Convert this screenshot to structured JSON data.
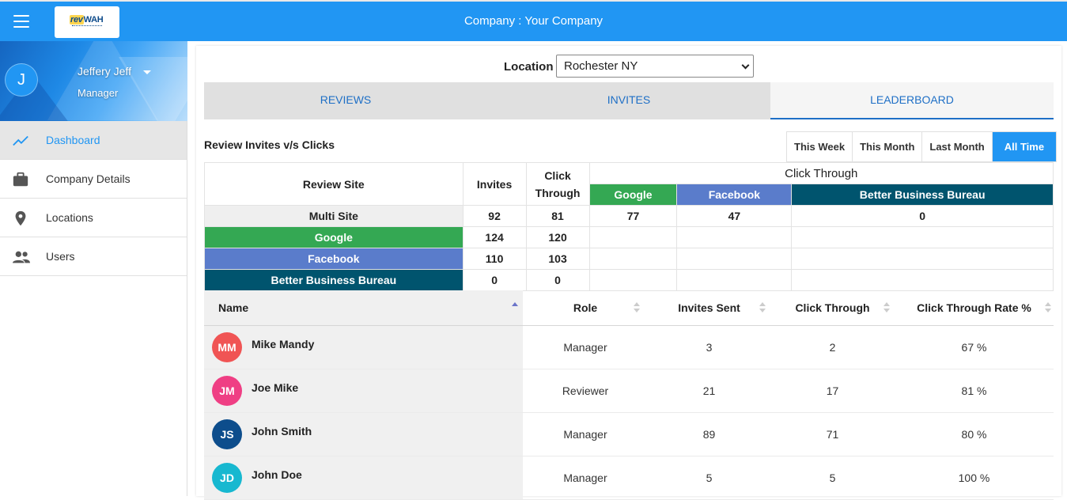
{
  "topbar": {
    "title": "Company : Your Company",
    "logo": {
      "rev": "rev",
      "wah": "WAH"
    }
  },
  "profile": {
    "initial": "J",
    "name": "Jeffery Jeff",
    "role": "Manager"
  },
  "nav": [
    {
      "label": "Dashboard",
      "icon": "trending-line-icon",
      "active": true
    },
    {
      "label": "Company Details",
      "icon": "briefcase-icon"
    },
    {
      "label": "Locations",
      "icon": "location-pin-icon"
    },
    {
      "label": "Users",
      "icon": "users-icon"
    }
  ],
  "location": {
    "label": "Location",
    "value": "Rochester NY"
  },
  "tabs": [
    {
      "label": "REVIEWS"
    },
    {
      "label": "INVITES"
    },
    {
      "label": "LEADERBOARD",
      "active": true
    }
  ],
  "section": {
    "title": "Review Invites v/s Clicks"
  },
  "ranges": [
    {
      "label": "This Week"
    },
    {
      "label": "This Month"
    },
    {
      "label": "Last Month"
    },
    {
      "label": "All Time",
      "active": true
    }
  ],
  "summary": {
    "head_site": "Review Site",
    "head_invites": "Invites",
    "head_click": "Click Through",
    "head_click_group": "Click Through",
    "sub_google": "Google",
    "sub_facebook": "Facebook",
    "sub_bbb": "Better Business Bureau",
    "rows": [
      {
        "site": "Multi Site",
        "invites": "92",
        "clicks": "81",
        "google": "77",
        "facebook": "47",
        "bbb": "0"
      },
      {
        "site": "Google",
        "invites": "124",
        "clicks": "120"
      },
      {
        "site": "Facebook",
        "invites": "110",
        "clicks": "103"
      },
      {
        "site": "Better Business Bureau",
        "invites": "0",
        "clicks": "0"
      }
    ]
  },
  "board": {
    "headers": {
      "name": "Name",
      "role": "Role",
      "sent": "Invites Sent",
      "click": "Click Through",
      "rate": "Click Through Rate %"
    },
    "rows": [
      {
        "initials": "MM",
        "name": "Mike Mandy",
        "role": "Manager",
        "sent": "3",
        "click": "2",
        "rate": "67 %",
        "color": "#f05454"
      },
      {
        "initials": "JM",
        "name": "Joe Mike",
        "role": "Reviewer",
        "sent": "21",
        "click": "17",
        "rate": "81 %",
        "color": "#ef3f84"
      },
      {
        "initials": "JS",
        "name": "John Smith",
        "role": "Manager",
        "sent": "89",
        "click": "71",
        "rate": "80 %",
        "color": "#0d4d8c"
      },
      {
        "initials": "JD",
        "name": "John Doe",
        "role": "Manager",
        "sent": "5",
        "click": "5",
        "rate": "100 %",
        "color": "#17b8d0"
      }
    ]
  }
}
